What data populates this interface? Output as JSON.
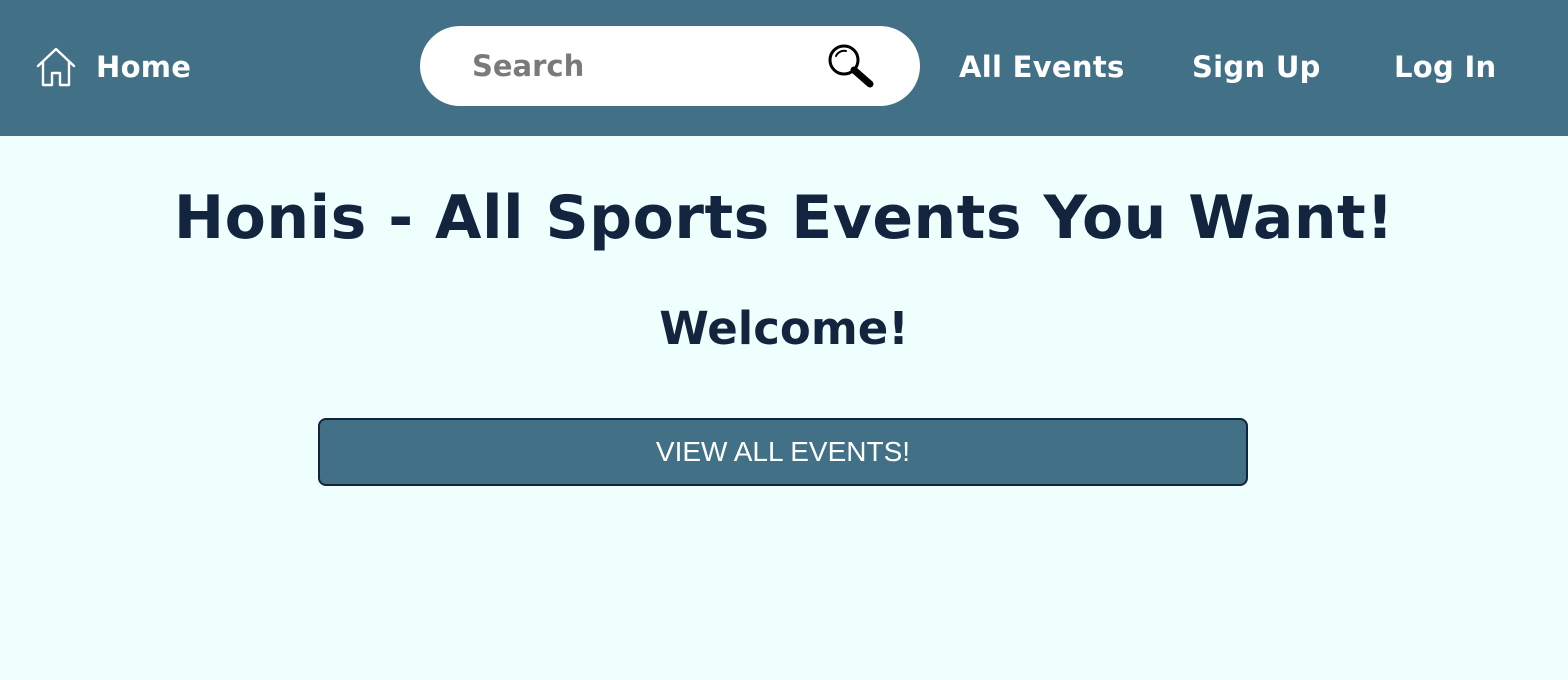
{
  "colors": {
    "navbar_bg": "#427087",
    "page_bg": "#effffe",
    "heading_text": "#13243f",
    "nav_text": "#ffffff",
    "search_placeholder": "#7a7a7a"
  },
  "navbar": {
    "home": {
      "icon": "home-icon",
      "label": "Home"
    },
    "search": {
      "placeholder": "Search",
      "value": "",
      "icon": "magnifier-icon"
    },
    "links": [
      {
        "label": "All Events"
      },
      {
        "label": "Sign Up"
      },
      {
        "label": "Log In"
      }
    ]
  },
  "main": {
    "title": "Honis - All Sports Events You Want!",
    "subtitle": "Welcome!",
    "cta_button": "VIEW ALL EVENTS!"
  }
}
